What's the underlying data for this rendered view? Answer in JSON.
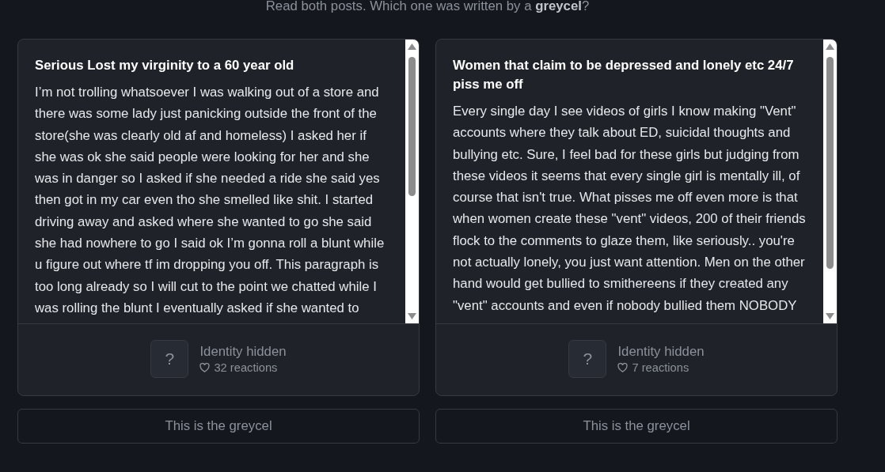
{
  "prompt": "Read both posts. Which one was written by a **greycel**?",
  "posts": [
    {
      "title": "Serious Lost my virginity to a 60 year old",
      "body": "I’m not trolling whatsoever I was walking out of a store and there was some lady just panicking outside the front of the store(she was clearly old af and homeless) I asked her if she was ok she said people were looking for her and she was in danger so I asked if she needed a ride she said yes then got in my car even tho she smelled like shit. I started driving away and asked where she wanted to go she said she had nowhere to go I said ok I’m gonna roll a blunt while u figure out where tf im dropping you off. This paragraph is too long already so I will cut to the point we chatted while I was rolling the blunt I eventually asked if she wanted to",
      "avatar": "?",
      "author": "Identity hidden",
      "reactions": "32 reactions",
      "button": "This is the greycel"
    },
    {
      "title": "Women that claim to be depressed and lonely etc 24/7 piss me off",
      "body": "Every single day I see videos of girls I know making \"Vent\" accounts where they talk about ED, suicidal thoughts and bullying etc. Sure, I feel bad for these girls but judging from these videos it seems that every single girl is mentally ill, of course that isn't true. What pisses me off even more is that when women create these \"vent\" videos, 200 of their friends flock to the comments to glaze them, like seriously.. you're not actually lonely, you just want attention. Men on the other hand would get bullied to smithereens if they created any \"vent\" accounts and even if nobody bullied them NOBODY",
      "avatar": "?",
      "author": "Identity hidden",
      "reactions": "7 reactions",
      "button": "This is the greycel"
    }
  ]
}
